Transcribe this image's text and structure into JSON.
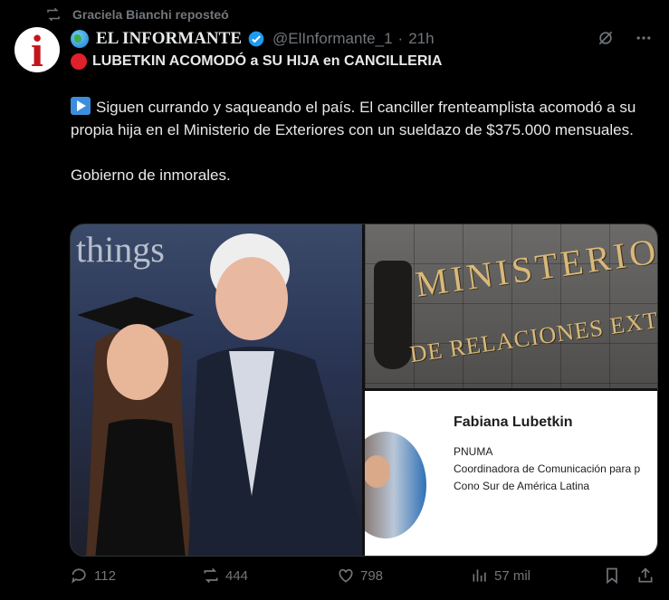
{
  "repost": {
    "text": "Graciela Bianchi reposteó"
  },
  "author": {
    "name": "EL INFORMANTE",
    "handle": "@ElInformante_1",
    "separator": "·",
    "time": "21h",
    "avatar_letter": "i"
  },
  "tweet": {
    "headline": "LUBETKIN ACOMODÓ a SU HIJA en CANCILLERIA",
    "paragraph1": "Siguen currando y saqueando el país. El canciller frenteamplista acomodó a su propia hija en el Ministerio de Exteriores con un sueldazo de $375.000 mensuales.",
    "paragraph2": "Gobierno de inmorales."
  },
  "media": {
    "photo_text": "things",
    "sign_line1": "MINISTERIO",
    "sign_line2": "DE RELACIONES EXTERIORES",
    "card": {
      "name": "Fabiana Lubetkin",
      "org": "PNUMA",
      "role_line1": "Coordinadora de Comunicación para p",
      "role_line2": "Cono Sur de América Latina"
    }
  },
  "actions": {
    "replies": "112",
    "reposts": "444",
    "likes": "798",
    "views": "57 mil"
  },
  "colors": {
    "background": "#000000",
    "text": "#e7e9ea",
    "muted": "#71767b",
    "verified": "#1d9bf0",
    "alert": "#e0202a"
  }
}
